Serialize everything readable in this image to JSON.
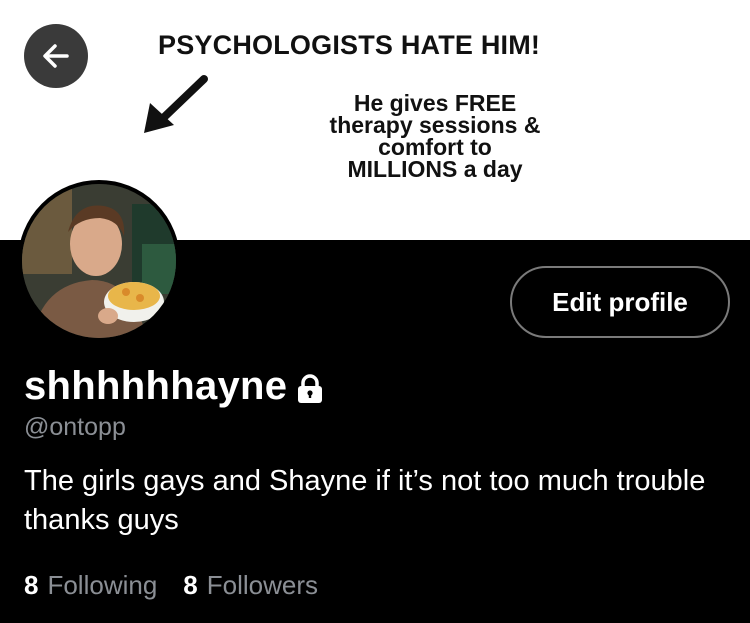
{
  "banner": {
    "headline": "PSYCHOLOGISTS HATE HIM!",
    "body_lines": [
      "He gives FREE",
      "therapy sessions &",
      "comfort to",
      "MILLIONS a day"
    ]
  },
  "profile": {
    "display_name": "shhhhhhayne",
    "handle": "@ontopp",
    "locked": true,
    "bio": "The girls gays and Shayne if it’s not too much trouble thanks guys",
    "edit_label": "Edit profile"
  },
  "stats": {
    "following_count": "8",
    "following_label": "Following",
    "followers_count": "8",
    "followers_label": "Followers"
  },
  "colors": {
    "background": "#000000",
    "text_primary": "#ffffff",
    "text_secondary": "#8b8f95",
    "button_border": "#7a7a7a",
    "back_button": "#3a3a3a"
  },
  "icons": {
    "back": "arrow-left-icon",
    "lock": "lock-icon",
    "banner_arrow": "diagonal-arrow-icon"
  }
}
